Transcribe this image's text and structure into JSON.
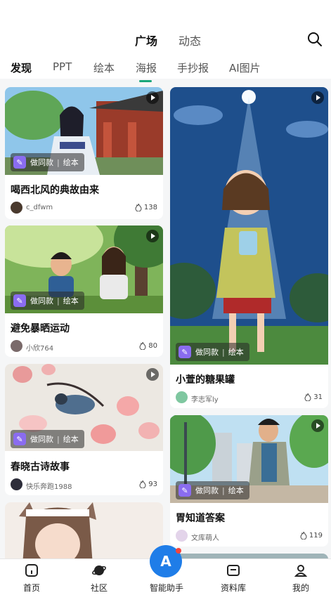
{
  "header": {
    "tabs": [
      "广场",
      "动态"
    ],
    "active_tab": "广场",
    "search_icon": "search-icon"
  },
  "categories": {
    "items": [
      "发现",
      "PPT",
      "绘本",
      "海报",
      "手抄报",
      "AI图片"
    ],
    "active": "发现"
  },
  "feed": {
    "badge_action": "做同款",
    "badge_type": "绘本",
    "cards": [
      {
        "title": "喝西北风的典故由来",
        "author": "c_dfwm",
        "likes": "138"
      },
      {
        "title": "避免暴晒运动",
        "author": "小欣764",
        "likes": "80"
      },
      {
        "title": "春晓古诗故事",
        "author": "快乐奔跑1988",
        "likes": "93"
      },
      {
        "title": "小萱的糖果罐",
        "author": "李志军ly",
        "likes": "31"
      },
      {
        "title": "胃知道答案",
        "author": "文库萌人",
        "likes": "119"
      }
    ]
  },
  "bottom_nav": {
    "items": [
      {
        "label": "首页",
        "icon": "home-icon"
      },
      {
        "label": "社区",
        "icon": "planet-icon"
      },
      {
        "label": "智能助手",
        "icon": "assistant-icon"
      },
      {
        "label": "资料库",
        "icon": "library-icon"
      },
      {
        "label": "我的",
        "icon": "profile-icon"
      }
    ],
    "assistant_glyph": "A"
  },
  "colors": {
    "accent": "#1aa67a",
    "fab": "#1f7de8",
    "badge_icon": "#8a6cf0",
    "notification": "#f2453d"
  }
}
